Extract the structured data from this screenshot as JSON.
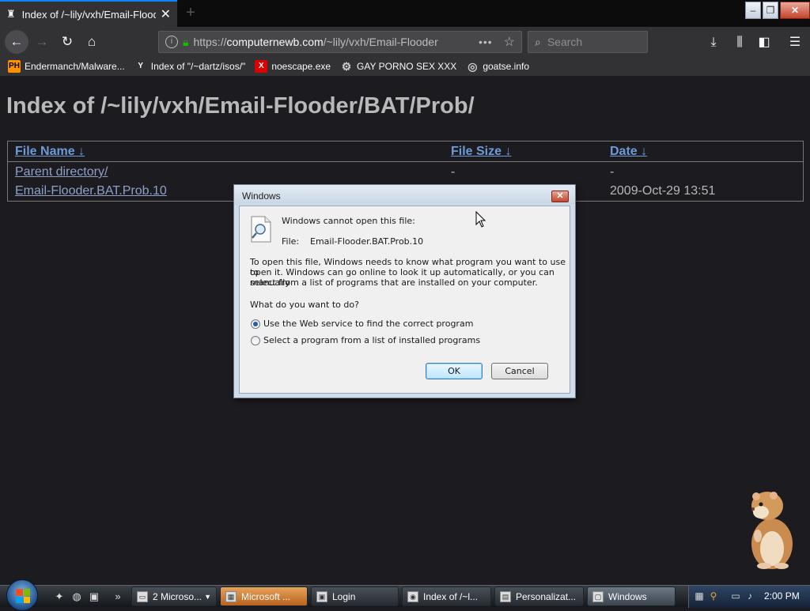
{
  "browser": {
    "tab_title": "Index of /~lily/vxh/Email-Flood",
    "tab_close": "✕",
    "new_tab": "+",
    "url_prefix": "https://",
    "url_host": "computernewb.com",
    "url_path": "/~lily/vxh/Email-Flooder",
    "more_actions": "•••",
    "search_placeholder": "Search",
    "bookmarks": [
      {
        "icon": "PH",
        "label": "Endermanch/Malware..."
      },
      {
        "icon": "Y",
        "label": "Index of \"/~dartz/isos/\""
      },
      {
        "icon": "X",
        "label": "noescape.exe"
      },
      {
        "icon": "⚙",
        "label": "GAY PORNO SEX XXX"
      },
      {
        "icon": "◎",
        "label": "goatse.info"
      }
    ]
  },
  "page": {
    "title": "Index of /~lily/vxh/Email-Flooder/BAT/Prob/",
    "headers": {
      "name": "File Name ↓",
      "size": "File Size ↓",
      "date": "Date ↓"
    },
    "rows": [
      {
        "name": "Parent directory/",
        "size": "-",
        "date": "-"
      },
      {
        "name": "Email-Flooder.BAT.Prob.10",
        "size": "",
        "date": "2009-Oct-29 13:51"
      }
    ]
  },
  "dialog": {
    "title": "Windows",
    "close": "✕",
    "cannot_open": "Windows cannot open this file:",
    "file_label": "File:",
    "file_name": "Email-Flooder.BAT.Prob.10",
    "explanation_1": "To open this file, Windows needs to know what program you want to use to",
    "explanation_2": "open it.  Windows can go online to look it up automatically, or you can manually",
    "explanation_3": "select from a list of programs that are installed on your computer.",
    "question": "What do you want to do?",
    "option_web": "Use the Web service to find the correct program",
    "option_list": "Select a program from a list of installed programs",
    "ok": "OK",
    "cancel": "Cancel"
  },
  "taskbar": {
    "tasks": [
      {
        "label": "2 Microso...",
        "icon": "▭"
      },
      {
        "label": "Microsoft ...",
        "icon": "▦"
      },
      {
        "label": "Login",
        "icon": "▣"
      },
      {
        "label": "Index of /~l...",
        "icon": "◉"
      },
      {
        "label": "Personalizat...",
        "icon": "▤"
      },
      {
        "label": "Windows",
        "icon": "▢"
      }
    ],
    "overflow": "»",
    "clock": "2:00 PM"
  }
}
